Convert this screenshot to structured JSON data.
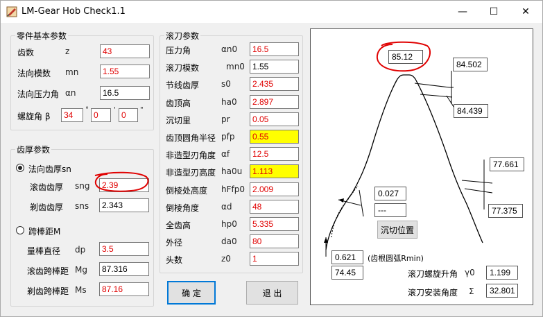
{
  "window": {
    "title": "LM-Gear Hob Check1.1",
    "minimize": "—",
    "maximize": "☐",
    "close": "✕"
  },
  "basic": {
    "title": "零件基本参数",
    "teeth_label": "齿数",
    "teeth_sym": "z",
    "teeth_val": "43",
    "module_label": "法向模数",
    "module_sym": "mn",
    "module_val": "1.55",
    "pa_label": "法向压力角",
    "pa_sym": "αn",
    "pa_val": "16.5",
    "helix_label": "螺旋角 β",
    "helix_deg": "34",
    "helix_min": "0",
    "helix_sec": "0",
    "deg_mark": "°",
    "min_mark": "'",
    "sec_mark": "\""
  },
  "thickness": {
    "title": "齿厚参数",
    "normal_label": "法向齿厚sn",
    "hob_label": "滚齿齿厚",
    "hob_sym": "sng",
    "hob_val": "2.39",
    "shave_label": "剃齿齿厚",
    "shave_sym": "sns",
    "shave_val": "2.343",
    "span_label": "跨棒距M",
    "dia_label": "量棒直径",
    "dia_sym": "dp",
    "dia_val": "3.5",
    "hobspan_label": "滚齿跨棒距",
    "hobspan_sym": "Mg",
    "hobspan_val": "87.316",
    "shavespan_label": "剃齿跨棒距",
    "shavespan_sym": "Ms",
    "shavespan_val": "87.16"
  },
  "hob": {
    "title": "滚刀参数",
    "rows": [
      {
        "label": "压力角",
        "sym": "αn0",
        "val": "16.5",
        "color": "red",
        "hl": false
      },
      {
        "label": "滚刀模数",
        "sym": "mn0",
        "val": "1.55",
        "color": "black",
        "hl": false
      },
      {
        "label": "节线齿厚",
        "sym": "s0",
        "val": "2.435",
        "color": "red",
        "hl": false
      },
      {
        "label": "齿顶高",
        "sym": "ha0",
        "val": "2.897",
        "color": "red",
        "hl": false
      },
      {
        "label": "沉切里",
        "sym": "pr",
        "val": "0.05",
        "color": "red",
        "hl": false
      },
      {
        "label": "齿顶圆角半径",
        "sym": "pfp",
        "val": "0.55",
        "color": "red",
        "hl": true
      },
      {
        "label": "非造型刃角度",
        "sym": "αf",
        "val": "12.5",
        "color": "red",
        "hl": false
      },
      {
        "label": "非造型刃高度",
        "sym": "ha0u",
        "val": "1.113",
        "color": "red",
        "hl": true
      },
      {
        "label": "倒棱处高度",
        "sym": "hFfp0",
        "val": "2.009",
        "color": "red",
        "hl": false
      },
      {
        "label": "倒棱角度",
        "sym": "αd",
        "val": "48",
        "color": "red",
        "hl": false
      },
      {
        "label": "全齿高",
        "sym": "hp0",
        "val": "5.335",
        "color": "red",
        "hl": false
      },
      {
        "label": "外径",
        "sym": "da0",
        "val": "80",
        "color": "red",
        "hl": false
      },
      {
        "label": "头数",
        "sym": "z0",
        "val": "1",
        "color": "red",
        "hl": false
      }
    ]
  },
  "buttons": {
    "ok": "确 定",
    "exit": "退 出",
    "undercut": "沉切位置"
  },
  "diagram": {
    "top_val": "85.12",
    "right_top1": "84.502",
    "right_top2": "84.439",
    "right_mid1": "77.661",
    "right_mid2": "77.375",
    "left_upper": "0.027",
    "left_lower": "---",
    "rmin_val": "0.621",
    "rmin_label": "(齿根圆弧Rmin)",
    "bottom_val": "74.45",
    "helix_label": "滚刀螺旋升角",
    "helix_sym": "γ0",
    "helix_val": "1.199",
    "install_label": "滚刀安装角度",
    "install_sym": "Σ",
    "install_val": "32.801"
  },
  "colors": {
    "annotation": "#e00000",
    "highlight": "#ffff00",
    "accent": "#0078d7"
  }
}
